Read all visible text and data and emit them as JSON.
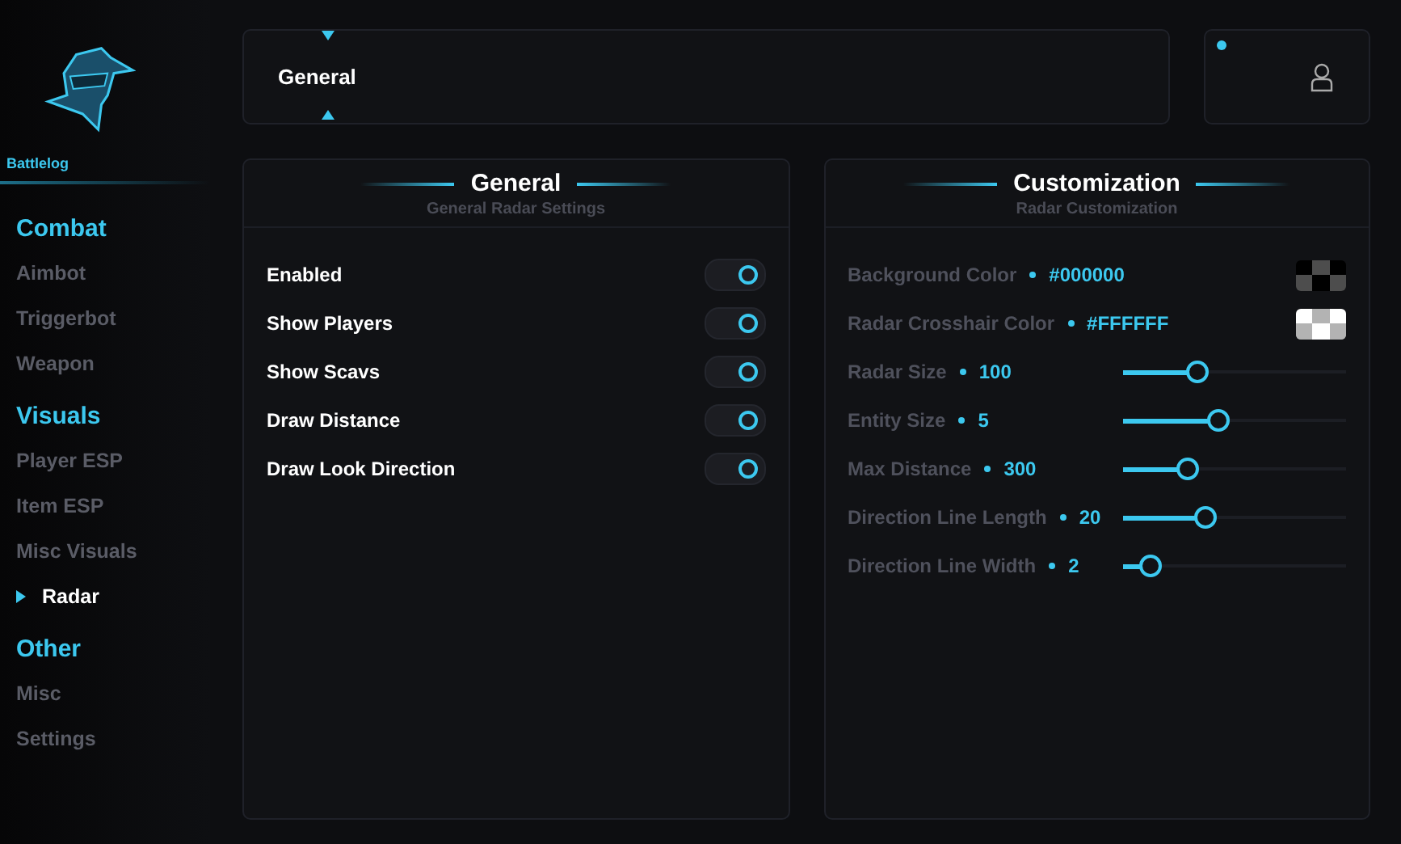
{
  "brand": {
    "name": "Battlelog"
  },
  "sidebar": {
    "groups": [
      {
        "heading": "Combat",
        "items": [
          {
            "label": "Aimbot",
            "selected": false
          },
          {
            "label": "Triggerbot",
            "selected": false
          },
          {
            "label": "Weapon",
            "selected": false
          }
        ]
      },
      {
        "heading": "Visuals",
        "items": [
          {
            "label": "Player ESP",
            "selected": false
          },
          {
            "label": "Item ESP",
            "selected": false
          },
          {
            "label": "Misc Visuals",
            "selected": false
          },
          {
            "label": "Radar",
            "selected": true
          }
        ]
      },
      {
        "heading": "Other",
        "items": [
          {
            "label": "Misc",
            "selected": false
          },
          {
            "label": "Settings",
            "selected": false
          }
        ]
      }
    ]
  },
  "header": {
    "tab": "General",
    "online": true
  },
  "panels": [
    {
      "title": "General",
      "subtitle": "General Radar Settings",
      "rows": [
        {
          "kind": "toggle",
          "label": "Enabled",
          "on": true
        },
        {
          "kind": "toggle",
          "label": "Show Players",
          "on": true
        },
        {
          "kind": "toggle",
          "label": "Show Scavs",
          "on": true
        },
        {
          "kind": "toggle",
          "label": "Draw Distance",
          "on": true
        },
        {
          "kind": "toggle",
          "label": "Draw Look Direction",
          "on": true
        }
      ]
    },
    {
      "title": "Customization",
      "subtitle": "Radar Customization",
      "rows": [
        {
          "kind": "color",
          "label": "Background Color",
          "value": "#000000",
          "color": "#000000"
        },
        {
          "kind": "color",
          "label": "Radar Crosshair Color",
          "value": "#FFFFFF",
          "color": "#ffffff"
        },
        {
          "kind": "slider",
          "label": "Radar Size",
          "value": "100",
          "level": 0.33
        },
        {
          "kind": "slider",
          "label": "Entity Size",
          "value": "5",
          "level": 0.43
        },
        {
          "kind": "slider",
          "label": "Max Distance",
          "value": "300",
          "level": 0.29
        },
        {
          "kind": "slider",
          "label": "Direction Line Length",
          "value": "20",
          "level": 0.37
        },
        {
          "kind": "slider",
          "label": "Direction Line Width",
          "value": "2",
          "level": 0.12
        }
      ]
    }
  ]
}
